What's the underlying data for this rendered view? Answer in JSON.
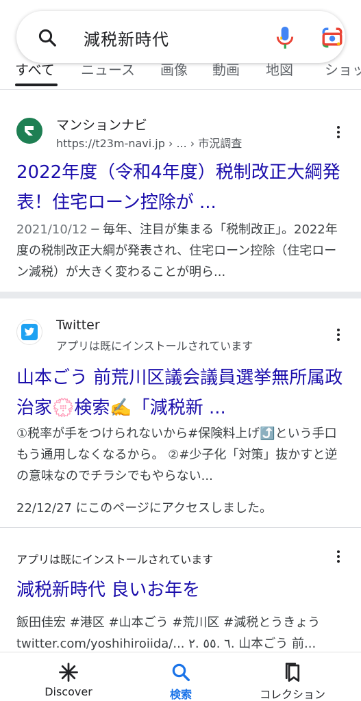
{
  "search": {
    "query": "減税新時代"
  },
  "tabs": [
    {
      "label": "すべて"
    },
    {
      "label": "ニュース"
    },
    {
      "label": "画像"
    },
    {
      "label": "動画"
    },
    {
      "label": "地図"
    },
    {
      "label": "ショッ"
    }
  ],
  "results": [
    {
      "site_name": "マンションナビ",
      "url": "https://t23m-navi.jp › ... › 市況調査",
      "title": "2022年度（令和4年度）税制改正大綱発表！住宅ローン控除が ...",
      "date": "2021/10/12",
      "snippet": " ─ 毎年、注目が集まる「税制改正」。2022年度の税制改正大綱が発表され、住宅ローン控除（住宅ローン減税）が大きく変わることが明ら..."
    },
    {
      "site_name": "Twitter",
      "url": "アプリは既にインストールされています",
      "title": "山本ごう 前荒川区議会議員選挙無所属政治家💮検索✍️「減税新 ...",
      "snippet": "①税率が手をつけられないから#保険料上げ⤴️という手口もう通用しなくなるから。 ②#少子化「対策」抜かすと逆の意味なのでチラシでもやらない...",
      "visited": "22/12/27 にこのページにアクセスしました。"
    },
    {
      "app_note": "アプリは既にインストールされています",
      "title": "減税新時代 良いお年を",
      "snippet": "飯田佳宏 #港区 #山本ごう #荒川区 #減税とうきょう twitter.com/yoshihiroiida/... ٦ .٥٥ .٢. 山本ごう 前..."
    }
  ],
  "bottom_nav": [
    {
      "label": "Discover",
      "icon": "asterisk-icon"
    },
    {
      "label": "検索",
      "icon": "search-icon",
      "active": true
    },
    {
      "label": "コレクション",
      "icon": "bookmarks-icon"
    }
  ],
  "colors": {
    "link": "#1a0dab",
    "accent": "#1a73e8",
    "mansion_navi": "#1e7f53",
    "twitter": "#1da1f2"
  }
}
